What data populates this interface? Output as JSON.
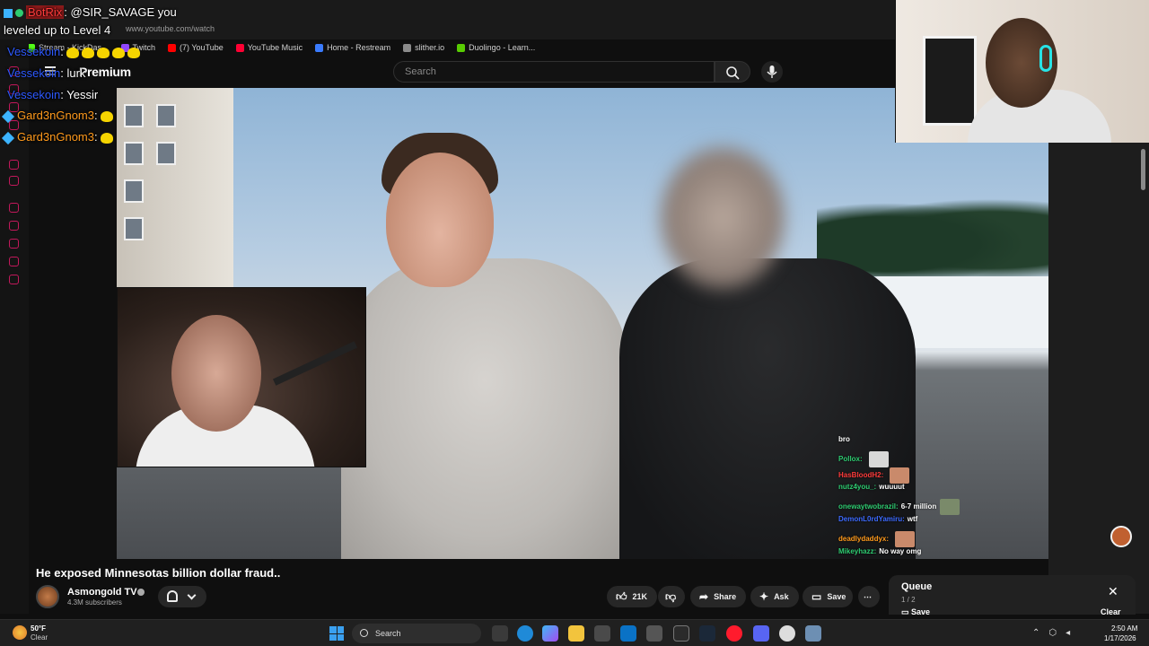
{
  "browser": {
    "url": "www.youtube.com/watch",
    "bookmarks": [
      {
        "label": "Stream - KickDas...",
        "color": "#53fc18"
      },
      {
        "label": "Twitch",
        "color": "#9146ff"
      },
      {
        "label": "(7) YouTube",
        "color": "#ff0000"
      },
      {
        "label": "YouTube Music",
        "color": "#ff0033"
      },
      {
        "label": "Home - Restream",
        "color": "#3a7bfd"
      },
      {
        "label": "slither.io",
        "color": "#8b8b8b"
      },
      {
        "label": "Duolingo - Learn...",
        "color": "#58cc02"
      }
    ]
  },
  "youtube_header": {
    "logo_text": "Premium",
    "search_placeholder": "Search"
  },
  "stream_overlay": {
    "bot_line": {
      "user": "BotRix",
      "text": ": @SIR_SAVAGE you"
    },
    "bot_line2": "leveled up to Level 4",
    "lines": [
      {
        "user": "Vessekoin",
        "text": ":",
        "user_color": "#2d59ff"
      },
      {
        "user": "Vessekoin",
        "text": ": lurk",
        "user_color": "#2d59ff"
      },
      {
        "user": "Vessekoin",
        "text": ": Yessir",
        "user_color": "#2d59ff"
      },
      {
        "user": "Gard3nGnom3",
        "text": ":",
        "user_color": "#ff9a1c"
      },
      {
        "user": "Gard3nGnom3",
        "text": ":",
        "user_color": "#ff9a1c"
      }
    ]
  },
  "video_chat": [
    {
      "user": "bro",
      "text": "",
      "user_color": "#ffffff",
      "thumb": ""
    },
    {
      "user": "Pollox:",
      "text": "",
      "user_color": "#2ecc71",
      "thumb": "#d8d8d8"
    },
    {
      "user": "HasBloodH2:",
      "text": "",
      "user_color": "#ff3b3b",
      "thumb": "#c98a6b"
    },
    {
      "user": "nutz4you_:",
      "text": "wuuuut",
      "user_color": "#2ecc71",
      "thumb": ""
    },
    {
      "user": "onewaytwobrazil:",
      "text": "6-7 million",
      "user_color": "#2ecc71",
      "thumb": "#7a8a6a"
    },
    {
      "user": "DemonL0rdYamiru:",
      "text": "wtf",
      "user_color": "#3d6bff",
      "thumb": ""
    },
    {
      "user": "deadlydaddyx:",
      "text": "",
      "user_color": "#ff9a1c",
      "thumb": "#c98a6b"
    },
    {
      "user": "Mikeyhazz:",
      "text": "No way omg",
      "user_color": "#2ecc71",
      "thumb": ""
    }
  ],
  "video": {
    "title": "He exposed Minnesotas billion dollar fraud..",
    "channel": "Asmongold TV",
    "subscribers": "4.3M subscribers",
    "likes": "21K",
    "share_label": "Share",
    "ask_label": "Ask",
    "save_label": "Save",
    "more_label": "⋯"
  },
  "queue": {
    "title": "Queue",
    "count": "1 / 2",
    "save_label": "Save",
    "clear_label": "Clear"
  },
  "taskbar": {
    "temp": "50°F",
    "weather": "Clear",
    "search_label": "Search",
    "time": "2:50 AM",
    "date": "1/17/2026"
  }
}
